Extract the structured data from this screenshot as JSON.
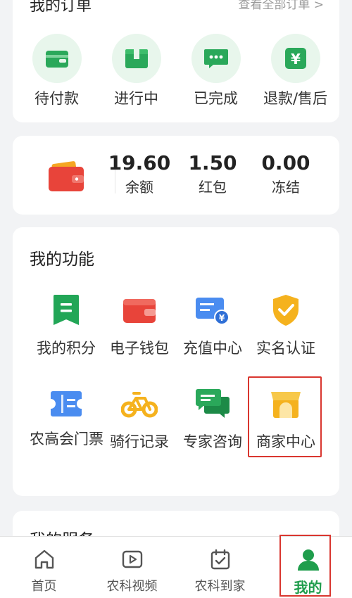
{
  "orders": {
    "title": "我的订单",
    "view_all": "查看全部订单 >",
    "items": [
      {
        "label": "待付款",
        "icon": "wallet-icon"
      },
      {
        "label": "进行中",
        "icon": "box-icon"
      },
      {
        "label": "已完成",
        "icon": "chat-dots-icon"
      },
      {
        "label": "退款/售后",
        "icon": "yen-icon"
      }
    ]
  },
  "wallet": {
    "stats": [
      {
        "value": "19.60",
        "label": "余额"
      },
      {
        "value": "1.50",
        "label": "红包"
      },
      {
        "value": "0.00",
        "label": "冻结"
      }
    ]
  },
  "features": {
    "title": "我的功能",
    "items": [
      {
        "label": "我的积分",
        "icon": "points-icon"
      },
      {
        "label": "电子钱包",
        "icon": "e-wallet-icon"
      },
      {
        "label": "充值中心",
        "icon": "recharge-card-icon"
      },
      {
        "label": "实名认证",
        "icon": "verified-shield-icon"
      },
      {
        "label": "农高会门票",
        "icon": "ticket-icon"
      },
      {
        "label": "骑行记录",
        "icon": "bicycle-icon"
      },
      {
        "label": "专家咨询",
        "icon": "consult-chat-icon"
      },
      {
        "label": "商家中心",
        "icon": "store-icon"
      }
    ]
  },
  "services": {
    "title": "我的服务"
  },
  "tabbar": {
    "tabs": [
      {
        "label": "首页",
        "icon": "home-icon"
      },
      {
        "label": "农科视频",
        "icon": "video-play-icon"
      },
      {
        "label": "农科到家",
        "icon": "calendar-check-icon"
      },
      {
        "label": "我的",
        "icon": "user-icon"
      }
    ],
    "active_index": 3
  },
  "colors": {
    "accent_green": "#1f9d4c",
    "highlight_red": "#d9362f"
  }
}
